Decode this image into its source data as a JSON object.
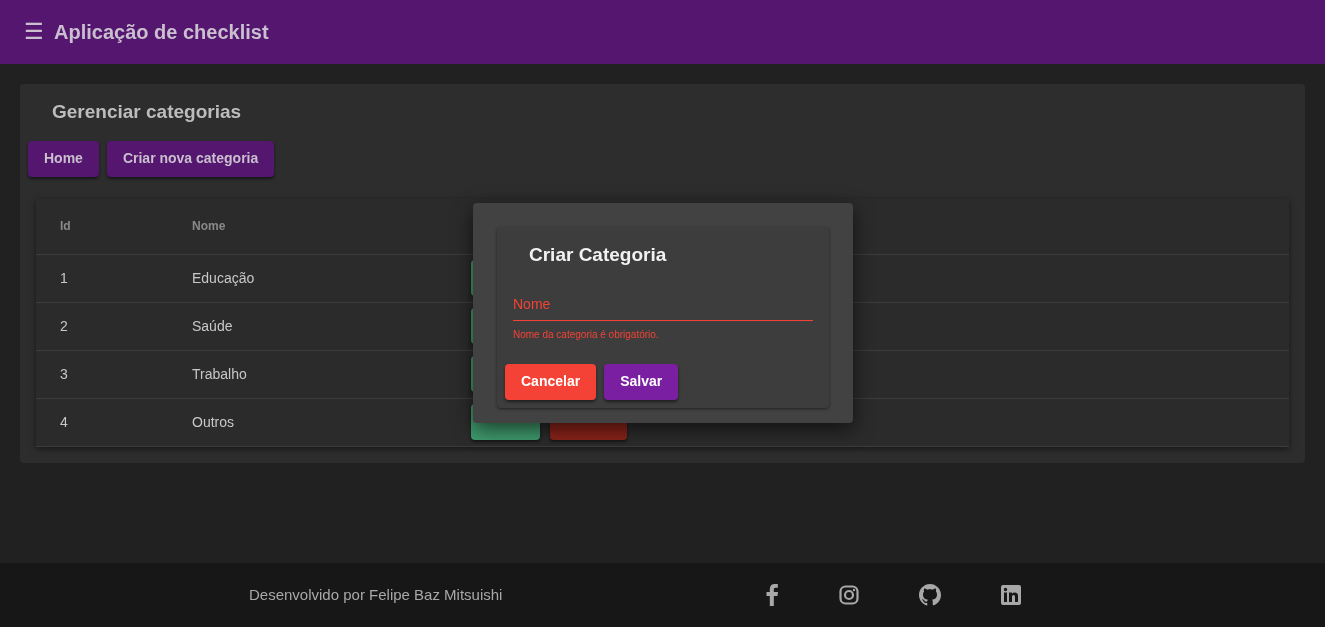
{
  "app_bar": {
    "menu_glyph": "☰",
    "title": "Aplicação de checklist"
  },
  "page": {
    "title": "Gerenciar categorias",
    "buttons": [
      "Home",
      "Criar nova categoria"
    ]
  },
  "table": {
    "columns": [
      "Id",
      "Nome"
    ],
    "rows": [
      {
        "id": "1",
        "name": "Educação",
        "actions": [
          {
            "kind": "edit"
          }
        ]
      },
      {
        "id": "2",
        "name": "Saúde",
        "actions": [
          {
            "kind": "edit"
          }
        ]
      },
      {
        "id": "3",
        "name": "Trabalho",
        "actions": [
          {
            "kind": "edit"
          }
        ]
      },
      {
        "id": "4",
        "name": "Outros",
        "actions": [
          {
            "kind": "edit"
          },
          {
            "kind": "delete"
          }
        ]
      }
    ]
  },
  "dialog": {
    "title": "Criar Categoria",
    "field": {
      "placeholder": "Nome",
      "invalid": true,
      "error": "Nome da categoria é obrigatório."
    },
    "buttons": [
      {
        "kind": "cancel",
        "label": "Cancelar"
      },
      {
        "kind": "save",
        "label": "Salvar"
      }
    ]
  },
  "footer": {
    "credit": "Desenvolvido por Felipe Baz Mitsuishi",
    "social": [
      {
        "kind": "facebook"
      },
      {
        "kind": "instagram"
      },
      {
        "kind": "github"
      },
      {
        "kind": "linkedin"
      }
    ]
  }
}
